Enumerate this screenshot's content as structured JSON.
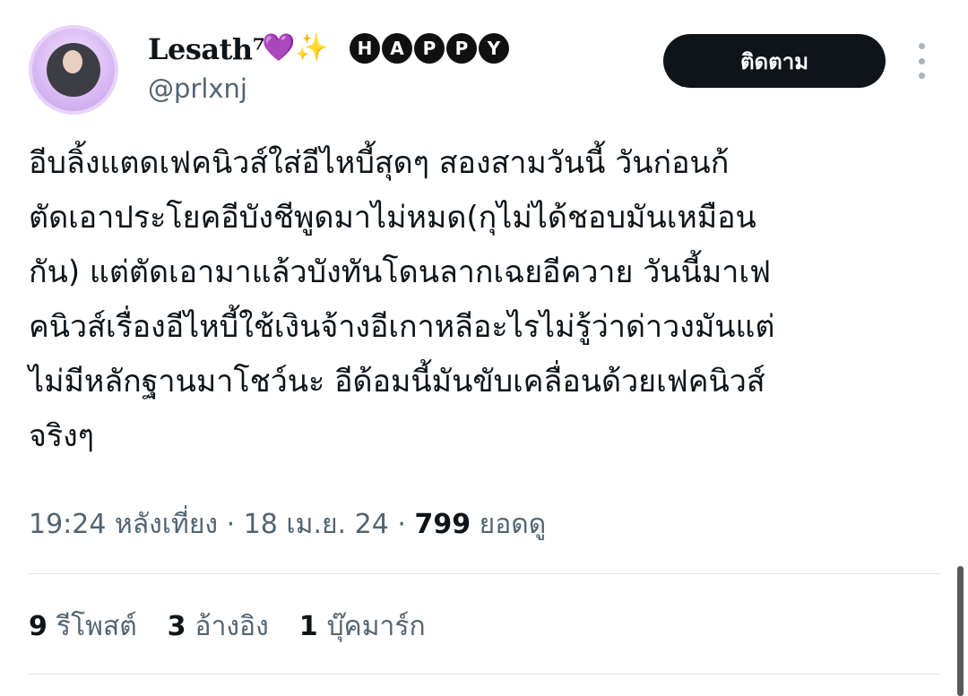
{
  "author": {
    "display_name": "Lesath⁷",
    "emoji": [
      "💜",
      "✨"
    ],
    "badge_letters": [
      "H",
      "A",
      "P",
      "P",
      "Y"
    ],
    "handle": "@prlxnj"
  },
  "follow_label": "ติดตาม",
  "tweet": {
    "lines": [
      "อีบลิ้งแตดเฟคนิวส์ใส่อีไหบี้สุดๆ สองสามวันนี้ วันก่อนก้",
      "ตัดเอาประโยคอีบังชีพูดมาไม่หมด(กุไม่ได้ชอบมันเหมือน",
      "กัน) แต่ตัดเอามาแล้วบังทันโดนลากเฉยอีควาย วันนี้มาเฟ",
      "คนิวส์เรื่องอีไหบี้ใช้เงินจ้างอีเกาหลีอะไรไม่รู้ว่าด่าวงมันแต่",
      "ไม่มีหลักฐานมาโชว์นะ อีด้อมนี้มันขับเคลื่อนด้วยเฟคนิวส์",
      "จริงๆ"
    ]
  },
  "meta": {
    "time": "19:24 หลังเที่ยง",
    "sep": "·",
    "date": "18 เม.ย. 24",
    "views_count": "799",
    "views_label": "ยอดดู"
  },
  "stats": {
    "reposts_count": "9",
    "reposts_label": "รีโพสต์",
    "quotes_count": "3",
    "quotes_label": "อ้างอิง",
    "bookmarks_count": "1",
    "bookmarks_label": "บุ๊คมาร์ก"
  }
}
